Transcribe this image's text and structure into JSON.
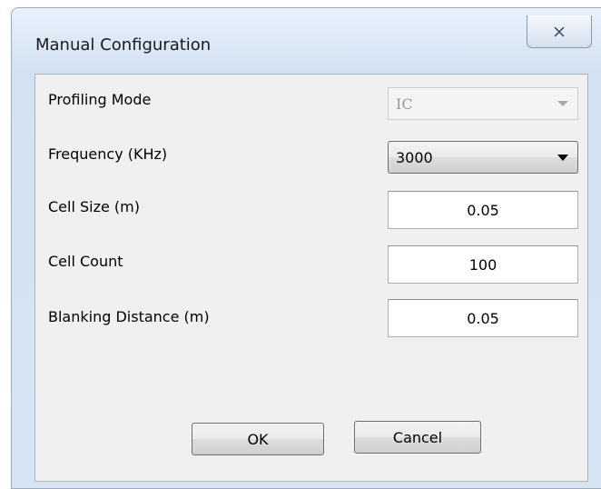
{
  "dialog": {
    "title": "Manual Configuration",
    "close_icon": "close-icon"
  },
  "fields": {
    "profiling_mode": {
      "label": "Profiling Mode",
      "value": "IC",
      "enabled": false
    },
    "frequency": {
      "label": "Frequency (KHz)",
      "value": "3000",
      "enabled": true
    },
    "cell_size": {
      "label": "Cell Size (m)",
      "value": "0.05"
    },
    "cell_count": {
      "label": "Cell Count",
      "value": "100"
    },
    "blanking_distance": {
      "label": "Blanking Distance (m)",
      "value": "0.05"
    }
  },
  "buttons": {
    "ok": "OK",
    "cancel": "Cancel"
  }
}
